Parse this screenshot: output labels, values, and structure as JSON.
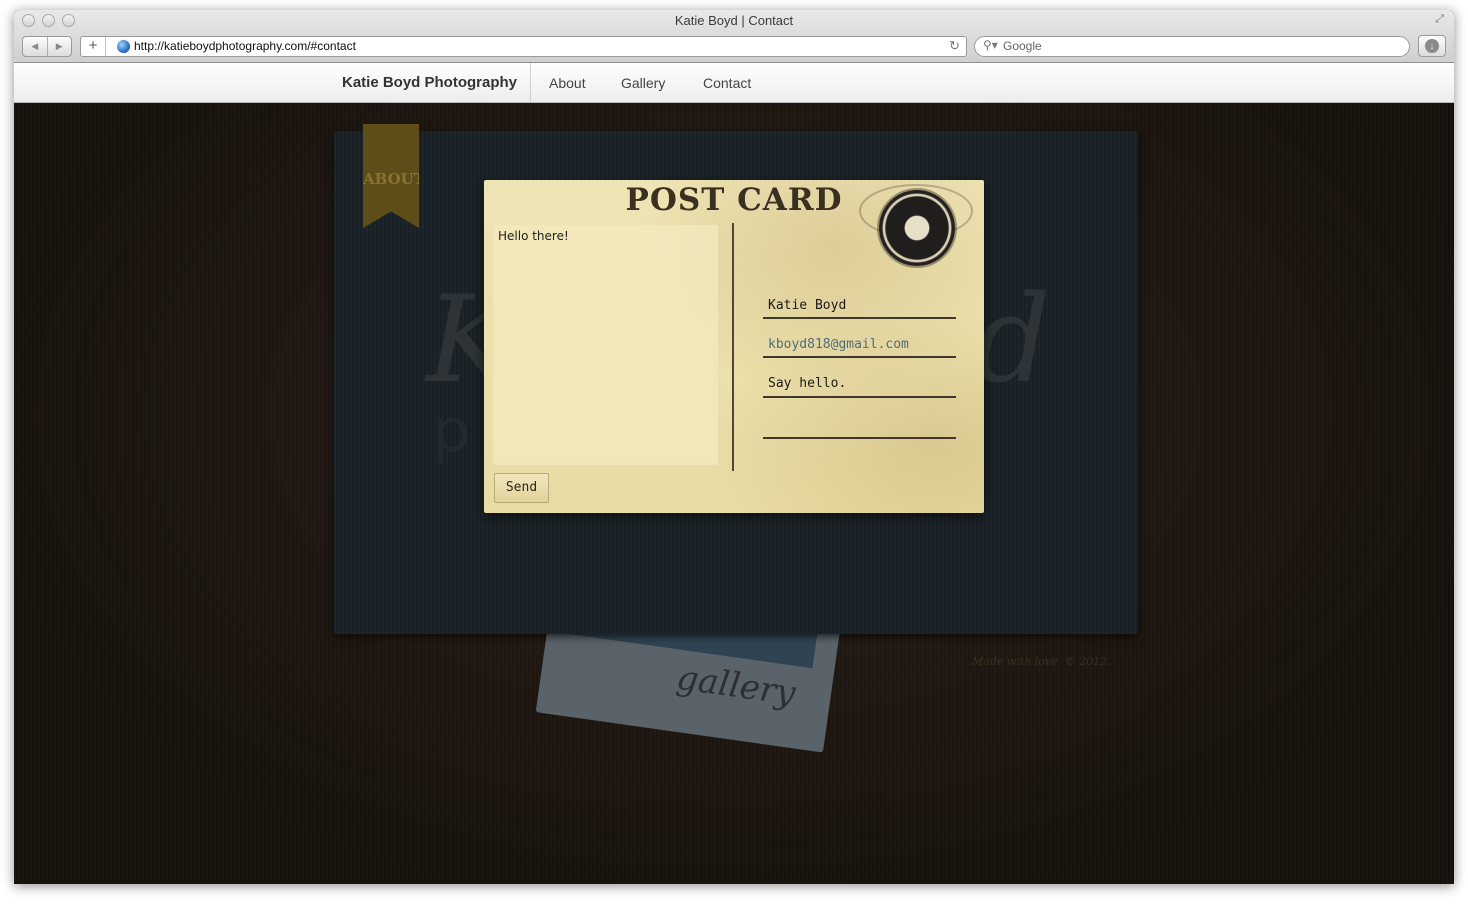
{
  "browser": {
    "window_title": "Katie Boyd | Contact",
    "url": "http://katieboydphotography.com/#contact",
    "search_placeholder": "Google"
  },
  "site_nav": {
    "brand": "Katie Boyd Photography",
    "links": [
      "About",
      "Gallery",
      "Contact"
    ]
  },
  "background": {
    "ribbon_label": "ABOUT",
    "script_k": "K",
    "script_d": "d",
    "script_p": "p",
    "gallery_label": "gallery",
    "footer": "Made with love. © 2012."
  },
  "postcard": {
    "title": "POST CARD",
    "message": "Hello there!",
    "name_value": "Katie Boyd",
    "email_value": "kboyd818@gmail.com",
    "subject_value": "Say hello.",
    "extra_value": "",
    "send_label": "Send"
  },
  "colors": {
    "page_background": "#1b1510",
    "book_cover": "#1a2227",
    "ribbon": "#5e4d19",
    "postcard_paper": "#efe4b4",
    "email_text": "#4e6d7a"
  }
}
